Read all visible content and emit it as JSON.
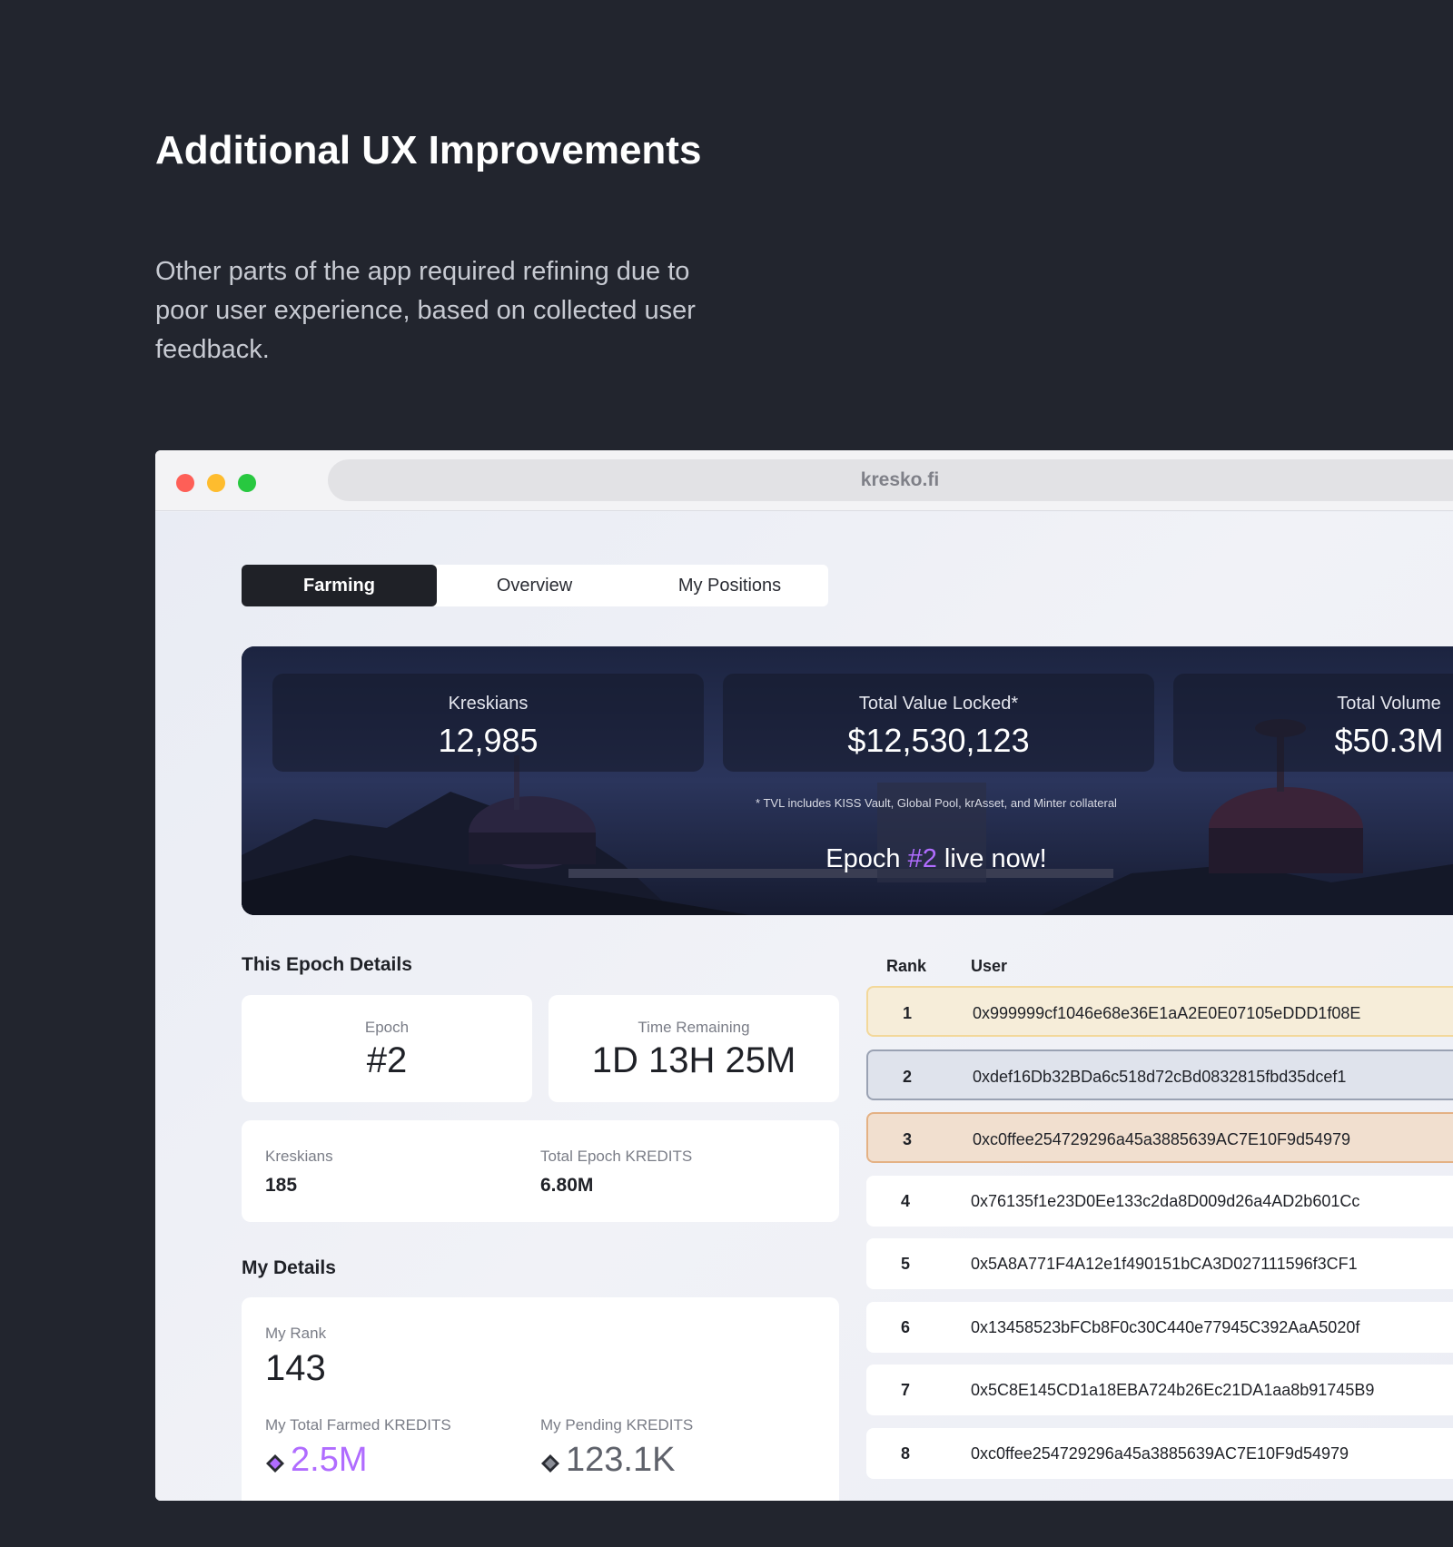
{
  "intro": {
    "heading": "Additional UX Improvements",
    "text": "Other parts of the app required refining due to poor user experience, based on collected user feedback."
  },
  "browser": {
    "url": "kresko.fi"
  },
  "tabs": [
    {
      "label": "Farming",
      "active": true
    },
    {
      "label": "Overview",
      "active": false
    },
    {
      "label": "My Positions",
      "active": false
    }
  ],
  "hero": {
    "stats": [
      {
        "label": "Kreskians",
        "value": "12,985"
      },
      {
        "label": "Total Value Locked*",
        "value": "$12,530,123"
      },
      {
        "label": "Total Volume",
        "value": "$50.3M"
      }
    ],
    "tvl_note": "* TVL includes KISS Vault, Global Pool, krAsset, and Minter collateral",
    "epoch_prefix": "Epoch ",
    "epoch_number": "#2",
    "epoch_suffix": " live now!"
  },
  "epoch_details": {
    "title": "This Epoch Details",
    "epoch_label": "Epoch",
    "epoch_value": "#2",
    "time_label": "Time Remaining",
    "time_value": "1D 13H 25M",
    "kreskians_label": "Kreskians",
    "kreskians_value": "185",
    "kredits_label": "Total Epoch KREDITS",
    "kredits_value": "6.80M"
  },
  "my_details": {
    "title": "My Details",
    "rank_label": "My Rank",
    "rank_value": "143",
    "farmed_label": "My Total Farmed KREDITS",
    "farmed_value": "2.5M",
    "pending_label": "My Pending KREDITS",
    "pending_value": "123.1K"
  },
  "leaderboard": {
    "rank_header": "Rank",
    "user_header": "User",
    "rows": [
      {
        "rank": "1",
        "user": "0x999999cf1046e68e36E1aA2E0E07105eDDD1f08E"
      },
      {
        "rank": "2",
        "user": "0xdef16Db32BDa6c518d72cBd0832815fbd35dcef1"
      },
      {
        "rank": "3",
        "user": "0xc0ffee254729296a45a3885639AC7E10F9d54979"
      },
      {
        "rank": "4",
        "user": "0x76135f1e23D0Ee133c2da8D009d26a4AD2b601Cc"
      },
      {
        "rank": "5",
        "user": "0x5A8A771F4A12e1f490151bCA3D027111596f3CF1"
      },
      {
        "rank": "6",
        "user": "0x13458523bFCb8F0c30C440e77945C392AaA5020f"
      },
      {
        "rank": "7",
        "user": "0x5C8E145CD1a18EBA724b26Ec21DA1aa8b91745B9"
      },
      {
        "rank": "8",
        "user": "0xc0ffee254729296a45a3885639AC7E10F9d54979"
      }
    ]
  },
  "colors": {
    "accent_purple": "#b06cff",
    "page_bg": "#22252e",
    "gold_row": "#f6edd9",
    "silver_row": "#dfe3ec",
    "bronze_row": "#f1dfcf"
  }
}
